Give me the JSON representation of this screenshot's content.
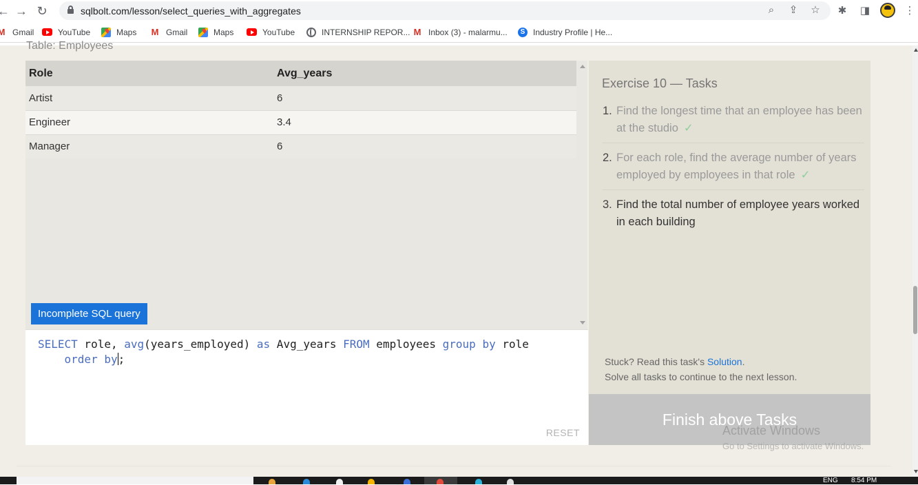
{
  "browser": {
    "url": "sqlbolt.com/lesson/select_queries_with_aggregates",
    "bookmarks": [
      {
        "label": "Gmail",
        "icon": "gmail-icon"
      },
      {
        "label": "YouTube",
        "icon": "youtube-icon"
      },
      {
        "label": "Maps",
        "icon": "maps-icon"
      },
      {
        "label": "Gmail",
        "icon": "gmail-icon"
      },
      {
        "label": "Maps",
        "icon": "maps-icon"
      },
      {
        "label": "YouTube",
        "icon": "youtube-icon"
      },
      {
        "label": "INTERNSHIP REPOR...",
        "icon": "globe-icon"
      },
      {
        "label": "Inbox (3) - malarmu...",
        "icon": "gmail-icon"
      },
      {
        "label": "Industry Profile | He...",
        "icon": "industry-icon"
      }
    ]
  },
  "lesson": {
    "table_caption": "Table: Employees",
    "results": {
      "headers": [
        "Role",
        "Avg_years"
      ],
      "rows": [
        [
          "Artist",
          "6"
        ],
        [
          "Engineer",
          "3.4"
        ],
        [
          "Manager",
          "6"
        ]
      ]
    },
    "status_badge": "Incomplete SQL query",
    "query": {
      "line1_keyword_select": "SELECT",
      "line1_a": " role, ",
      "line1_avg": "avg",
      "line1_b": "(years_employed) ",
      "line1_as": "as",
      "line1_c": " Avg_years ",
      "line1_from": "FROM",
      "line1_d": " employees ",
      "line1_group_by": "group by",
      "line1_e": " role",
      "line2_indent": "    ",
      "line2_order_by": "order by",
      "line2_end": ";"
    },
    "reset_label": "RESET"
  },
  "exercise": {
    "title": "Exercise 10 — Tasks",
    "tasks": [
      {
        "number": "1.",
        "text": "Find the longest time that an employee has been at the studio",
        "status": "done"
      },
      {
        "number": "2.",
        "text": "For each role, find the average number of years employed by employees in that role",
        "status": "done"
      },
      {
        "number": "3.",
        "text": "Find the total number of employee years worked in each building",
        "status": "active"
      }
    ],
    "check_mark": "✓",
    "stuck_prefix": "Stuck? Read this task's ",
    "stuck_link": "Solution",
    "stuck_suffix": ".",
    "solve_text": "Solve all tasks to continue to the next lesson.",
    "finish_label": "Finish above Tasks"
  },
  "watermark": {
    "title": "Activate Windows",
    "subtitle": "Go to Settings to activate Windows."
  },
  "taskbar": {
    "lang": "ENG",
    "time": "8:54 PM"
  },
  "colors": {
    "accent_blue": "#1a73d9",
    "sql_keyword": "#4a6dbf",
    "check_green": "#8fcf9e",
    "page_bg": "#f1eee7"
  }
}
